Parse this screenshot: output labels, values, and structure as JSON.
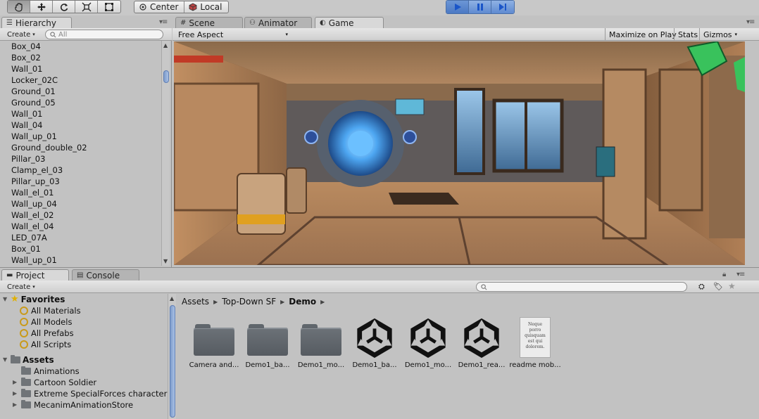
{
  "toolbar": {
    "transform_tools": [
      "hand-tool",
      "move-tool",
      "rotate-tool",
      "scale-tool",
      "rect-tool"
    ],
    "pivot_label": "Center",
    "space_label": "Local",
    "play_controls": [
      "play",
      "pause",
      "step"
    ]
  },
  "hierarchy": {
    "tab_label": "Hierarchy",
    "create_label": "Create",
    "search_placeholder": "All",
    "items": [
      "Box_04",
      "Box_02",
      "Wall_01",
      "Locker_02C",
      "Ground_01",
      "Ground_05",
      "Wall_01",
      "Wall_04",
      "Wall_up_01",
      "Ground_double_02",
      "Pillar_03",
      "Clamp_el_03",
      "Pillar_up_03",
      "Wall_el_01",
      "Wall_up_04",
      "Wall_el_02",
      "Wall_el_04",
      "LED_07A",
      "Box_01",
      "Wall_up_01"
    ]
  },
  "center_tabs": {
    "scene_label": "Scene",
    "animator_label": "Animator",
    "game_label": "Game"
  },
  "game": {
    "aspect_label": "Free Aspect",
    "maximize_label": "Maximize on Play",
    "stats_label": "Stats",
    "gizmos_label": "Gizmos"
  },
  "project": {
    "tab_label": "Project",
    "console_label": "Console",
    "create_label": "Create",
    "favorites_label": "Favorites",
    "favorites": [
      "All Materials",
      "All Models",
      "All Prefabs",
      "All Scripts"
    ],
    "assets_label": "Assets",
    "asset_folders": [
      "Animations",
      "Cartoon Soldier",
      "Extreme SpecialForces characters",
      "MecanimAnimationStore"
    ],
    "breadcrumb": [
      "Assets",
      "Top-Down SF",
      "Demo"
    ],
    "items": [
      {
        "label": "Camera and...",
        "kind": "folder"
      },
      {
        "label": "Demo1_ba...",
        "kind": "folder"
      },
      {
        "label": "Demo1_mo...",
        "kind": "folder"
      },
      {
        "label": "Demo1_ba...",
        "kind": "unity-scene"
      },
      {
        "label": "Demo1_mo...",
        "kind": "unity-scene"
      },
      {
        "label": "Demo1_rea...",
        "kind": "unity-scene"
      },
      {
        "label": "readme mob...",
        "kind": "document"
      }
    ],
    "readme_preview": "Neque porro quisquam est qui dolorem."
  },
  "colors": {
    "panel_bg": "#c2c2c2",
    "play_accent": "#5f8ad0",
    "scrollbar_thumb": "#7e9ccc"
  }
}
